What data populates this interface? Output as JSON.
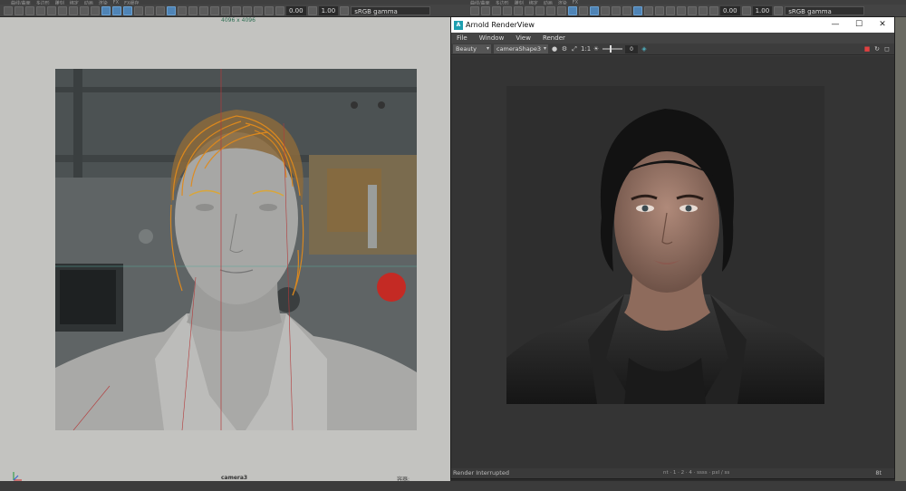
{
  "maya": {
    "menu_left": [
      "曲线/曲面",
      "多边形",
      "雕刻",
      "绑定",
      "动画",
      "渲染",
      "FX",
      "FX缓存"
    ],
    "menu_right": [
      "曲线/曲面",
      "多边形",
      "雕刻",
      "绑定",
      "动画",
      "渲染",
      "FX"
    ],
    "left_toolbar": {
      "value1": "0.00",
      "value2": "1.00",
      "gamma": "sRGB gamma"
    },
    "right_toolbar": {
      "value1": "0.00",
      "value2": "1.00",
      "gamma": "sRGB gamma"
    }
  },
  "viewport": {
    "resolution": "4096 x 4096",
    "camera": "camera3",
    "corner_label": "容器:"
  },
  "render_view": {
    "title": "Arnold RenderView",
    "logo": "A",
    "window_buttons": {
      "minimize": "—",
      "maximize": "☐",
      "close": "✕"
    },
    "menu": [
      "File",
      "Window",
      "View",
      "Render"
    ],
    "aov": "Beauty",
    "camera": "cameraShape3",
    "ratio": "1:1",
    "exposure": "0",
    "status": "Render Interrupted",
    "corner_code": "8t",
    "info_text": "nt · 1 · 2 · 4 · ssss · pxl / ss"
  },
  "colors": {
    "viewport_bg": "#c3c3c0",
    "render_bg": "#343434",
    "accent": "#4f84b6",
    "logo": "#1f9fb0",
    "hair_highlight": "#e08a1c"
  }
}
